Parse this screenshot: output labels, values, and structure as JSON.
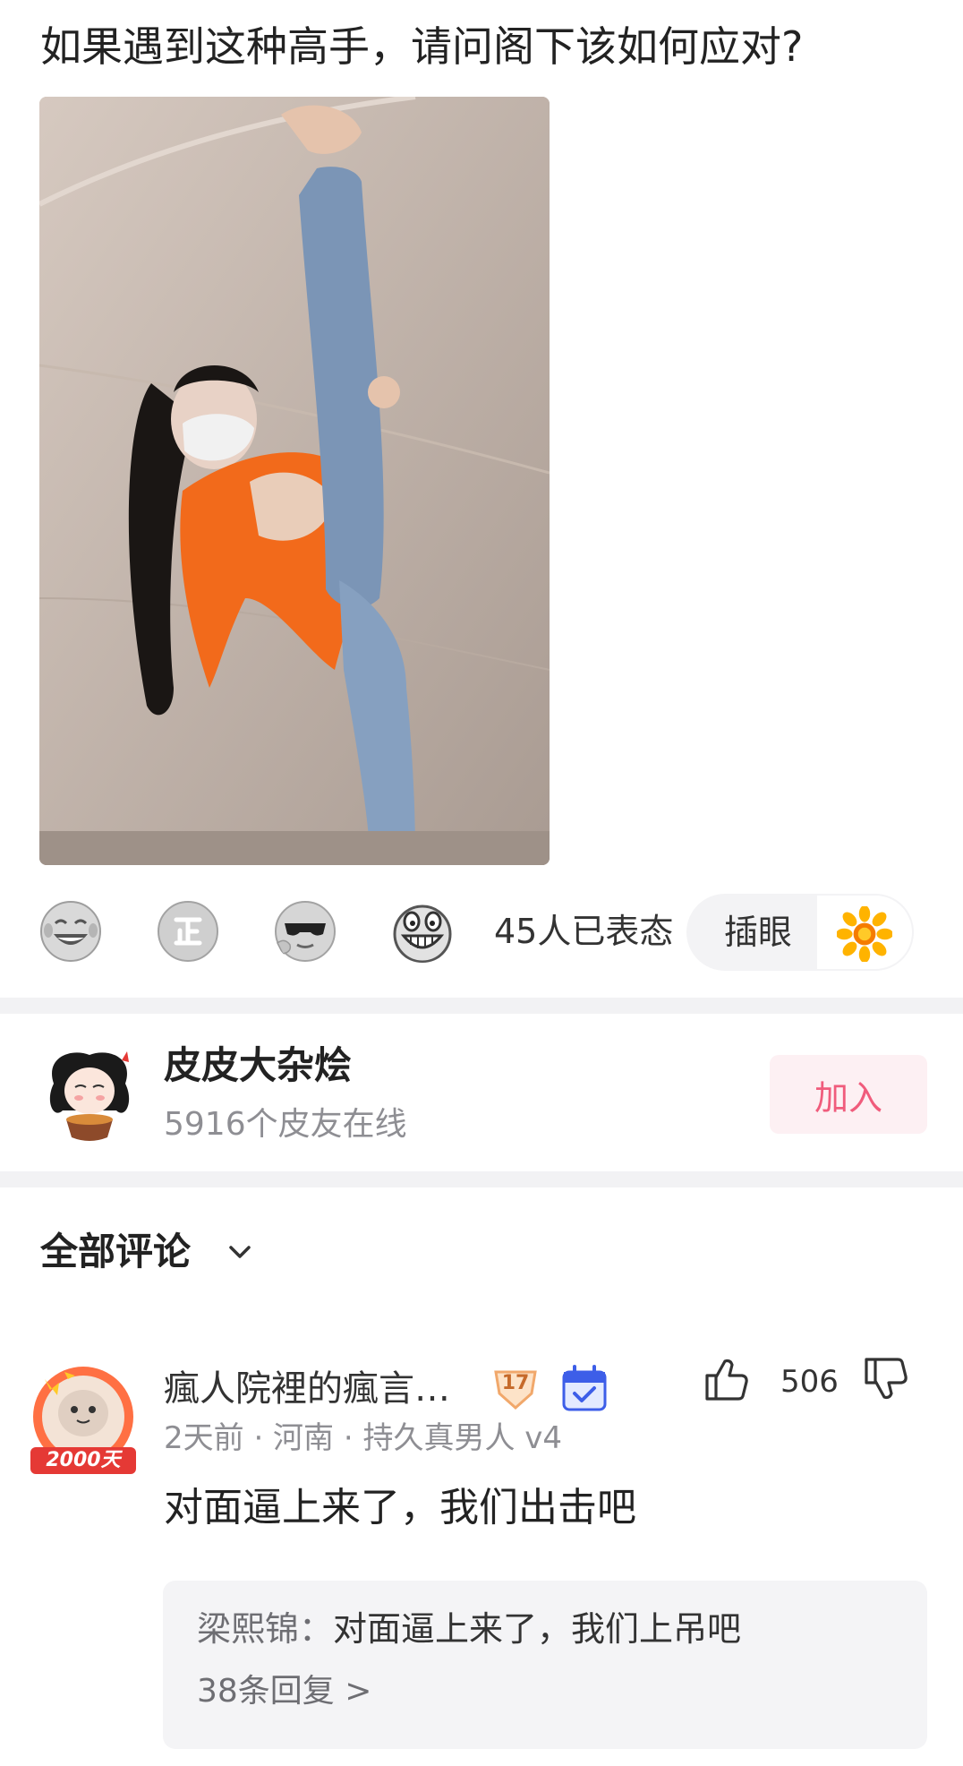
{
  "post": {
    "title": "如果遇到这种高手，请问阁下该如何应对?"
  },
  "reactions": {
    "emojis": [
      "laughing-crying-emoji",
      "zheng-emoji",
      "sunglasses-emoji",
      "grinning-emoji"
    ],
    "count_text": "45人已表态",
    "tag_label": "插眼",
    "tag_icon": "sunflower-icon"
  },
  "community": {
    "name": "皮皮大杂烩",
    "online_text": "5916个皮友在线",
    "join_label": "加入",
    "join_color": "#f05c7c"
  },
  "comments": {
    "header": "全部评论",
    "items": [
      {
        "username": "瘋人院裡的瘋言…",
        "level": "17",
        "avatar_badge": "2000天",
        "likes": "506",
        "meta": "2天前 · 河南 · 持久真男人 v4",
        "text": "对面逼上来了，我们出击吧",
        "reply": {
          "author": "梁熙锦：",
          "text": "对面逼上来了，我们上吊吧",
          "more": "38条回复 >"
        }
      }
    ]
  }
}
